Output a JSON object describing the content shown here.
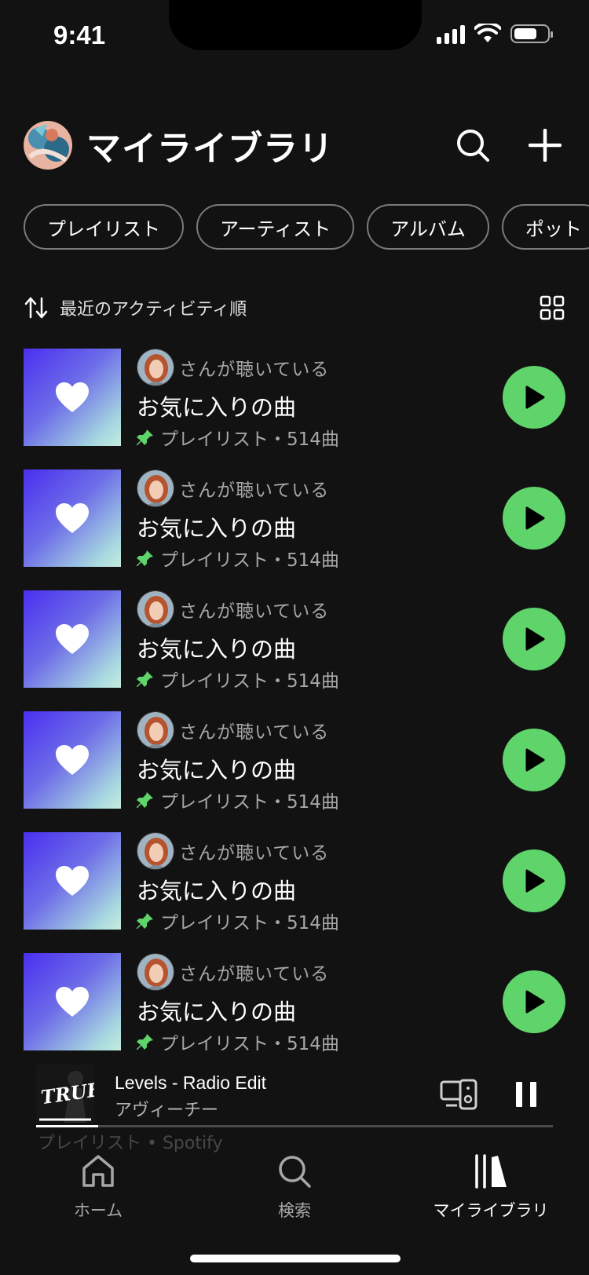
{
  "status": {
    "time": "9:41"
  },
  "header": {
    "title": "マイライブラリ"
  },
  "chips": [
    "プレイリスト",
    "アーティスト",
    "アルバム",
    "ポット"
  ],
  "sort": {
    "label": "最近のアクティビティ順"
  },
  "items": [
    {
      "owner_text": "さんが聴いている",
      "title": "お気に入りの曲",
      "meta": "プレイリスト・514曲"
    },
    {
      "owner_text": "さんが聴いている",
      "title": "お気に入りの曲",
      "meta": "プレイリスト・514曲"
    },
    {
      "owner_text": "さんが聴いている",
      "title": "お気に入りの曲",
      "meta": "プレイリスト・514曲"
    },
    {
      "owner_text": "さんが聴いている",
      "title": "お気に入りの曲",
      "meta": "プレイリスト・514曲"
    },
    {
      "owner_text": "さんが聴いている",
      "title": "お気に入りの曲",
      "meta": "プレイリスト・514曲"
    },
    {
      "owner_text": "さんが聴いている",
      "title": "お気に入りの曲",
      "meta": "プレイリスト・514曲"
    }
  ],
  "ghost_row": {
    "meta": "プレイリスト • Spotify"
  },
  "mini_player": {
    "art_text": "TRUE",
    "title": "Levels - Radio Edit",
    "artist": "アヴィーチー",
    "progress": 0.12
  },
  "tabs": [
    {
      "label": "ホーム",
      "icon": "home-icon"
    },
    {
      "label": "検索",
      "icon": "search-icon"
    },
    {
      "label": "マイライブラリ",
      "icon": "library-icon",
      "active": true
    }
  ],
  "colors": {
    "background": "#121212",
    "accent_green": "#5ed46b",
    "secondary_text": "#a7a7a7"
  }
}
